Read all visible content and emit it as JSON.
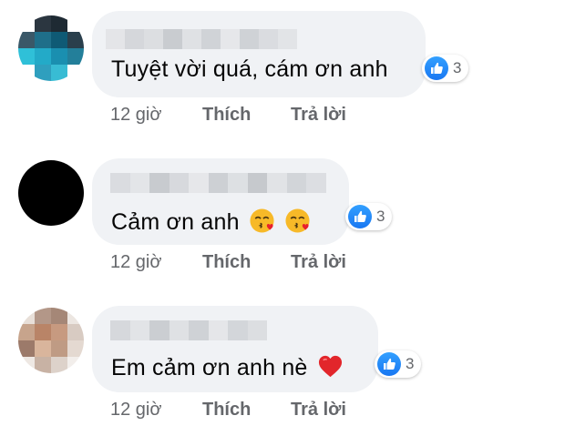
{
  "comments": [
    {
      "author_name": "",
      "text": "Tuyệt vời quá, cám ơn anh",
      "emojis": [],
      "reaction_icon": "like-icon",
      "reaction_count": "3",
      "time": "12 giờ",
      "like_label": "Thích",
      "reply_label": "Trả lời"
    },
    {
      "author_name": "",
      "text": "Cảm ơn anh",
      "emojis": [
        "kissing-face-with-heart-emoji",
        "kissing-face-with-heart-emoji"
      ],
      "reaction_icon": "like-icon",
      "reaction_count": "3",
      "time": "12 giờ",
      "like_label": "Thích",
      "reply_label": "Trả lời"
    },
    {
      "author_name": "",
      "text": "Em cảm ơn anh nè",
      "emojis": [
        "red-heart-emoji"
      ],
      "reaction_icon": "like-icon",
      "reaction_count": "3",
      "time": "12 giờ",
      "like_label": "Thích",
      "reply_label": "Trả lời"
    }
  ],
  "colors": {
    "bubble": "#f0f2f5",
    "text": "#050505",
    "secondary_text": "#65676b",
    "like_blue": "#1877f2"
  }
}
